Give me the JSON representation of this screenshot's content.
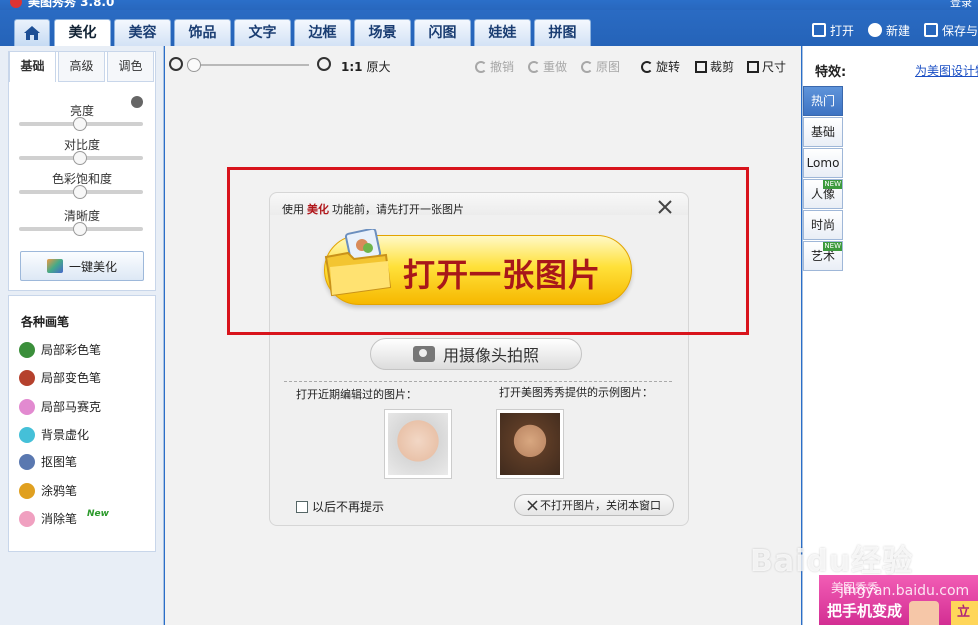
{
  "title_bar": {
    "app_title": "美图秀秀 3.8.0",
    "right_text": "登录"
  },
  "nav": {
    "tabs": [
      {
        "label": "美化",
        "active": true
      },
      {
        "label": "美容"
      },
      {
        "label": "饰品"
      },
      {
        "label": "文字"
      },
      {
        "label": "边框"
      },
      {
        "label": "场景"
      },
      {
        "label": "闪图"
      },
      {
        "label": "娃娃"
      },
      {
        "label": "拼图"
      }
    ],
    "open_label": "打开",
    "new_label": "新建",
    "save_label": "保存与"
  },
  "left_panel": {
    "subtabs": [
      "基础",
      "高级",
      "调色"
    ],
    "sliders": [
      "亮度",
      "对比度",
      "色彩饱和度",
      "清晰度"
    ],
    "one_click_label": "一键美化",
    "brush_title": "各种画笔",
    "brushes": [
      {
        "label": "局部彩色笔",
        "color": "#3b8f3b"
      },
      {
        "label": "局部变色笔",
        "color": "#b5412d"
      },
      {
        "label": "局部马赛克",
        "color": "#e28ad0"
      },
      {
        "label": "背景虚化",
        "color": "#45c0d8"
      },
      {
        "label": "抠图笔",
        "color": "#5a78b0"
      },
      {
        "label": "涂鸦笔",
        "color": "#e0a020"
      },
      {
        "label": "消除笔",
        "color": "#f0a0c0",
        "badge": "New"
      }
    ]
  },
  "toolbar": {
    "original_size_ratio": "1:1",
    "original_size_label": "原大",
    "undo": "撤销",
    "redo": "重做",
    "original": "原图",
    "rotate": "旋转",
    "crop": "裁剪",
    "size": "尺寸"
  },
  "dialog": {
    "msg_prefix": "使用",
    "msg_highlight": "美化",
    "msg_suffix": "功能前，请先打开一张图片",
    "open_button": "打开一张图片",
    "camera_button": "用摄像头拍照",
    "recent_label": "打开近期编辑过的图片：",
    "sample_label": "打开美图秀秀提供的示例图片：",
    "no_remind": "以后不再提示",
    "close_window": "不打开图片，关闭本窗口"
  },
  "right_panel": {
    "effects_label": "特效:",
    "design_link": "为美图设计特",
    "categories": [
      {
        "label": "热门",
        "active": true
      },
      {
        "label": "基础"
      },
      {
        "label": "Lomo"
      },
      {
        "label": "人像",
        "new": "NEW"
      },
      {
        "label": "时尚"
      },
      {
        "label": "艺术",
        "new": "NEW"
      }
    ]
  },
  "ad": {
    "top_text": "美图秀秀",
    "main_text": "把手机变成",
    "button": "立"
  },
  "watermark": {
    "brand": "Baidu经验",
    "url": "jingyan.baidu.com"
  },
  "colors": {
    "accent_blue": "#2a6ec8",
    "highlight_red": "#d8141c",
    "button_yellow": "#ffe13a"
  }
}
